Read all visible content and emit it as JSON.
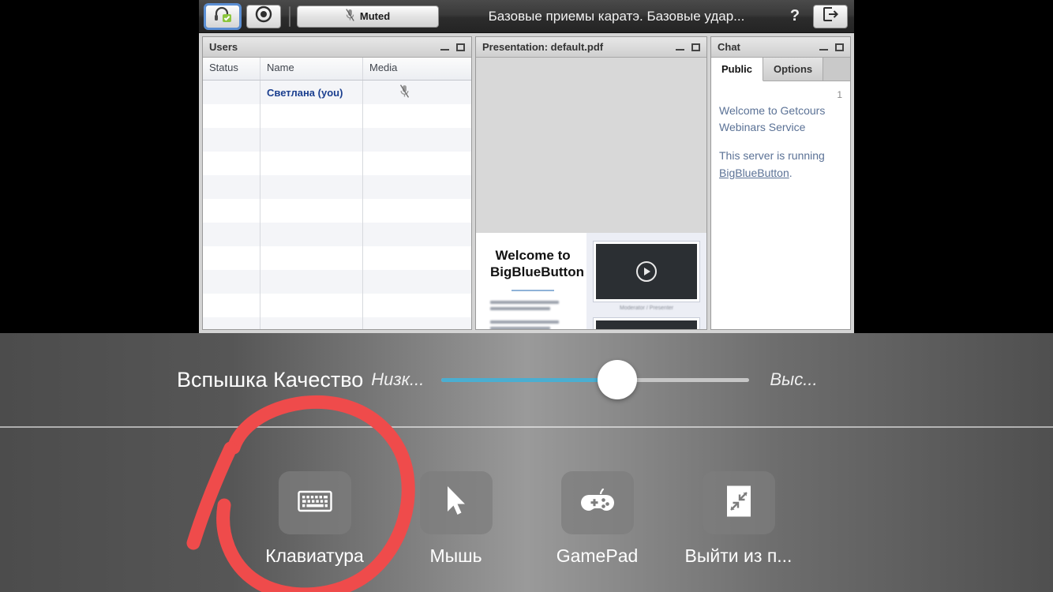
{
  "app": {
    "toolbar": {
      "audio_icon": "headset-check-icon",
      "webcam_icon": "record-circle-icon",
      "mute_button_label": "Muted",
      "mute_icon": "mic-muted-icon",
      "session_title": "Базовые приемы каратэ. Базовые удар...",
      "help_label": "?",
      "logout_icon": "logout-icon"
    },
    "users_panel": {
      "title": "Users",
      "minimize_icon": "minimize-icon",
      "maximize_icon": "maximize-icon",
      "columns": [
        "Status",
        "Name",
        "Media"
      ],
      "rows": [
        {
          "status": "",
          "name": "Светлана (you)",
          "media_icon": "mic-muted-icon",
          "self": true
        }
      ],
      "empty_row_count": 10
    },
    "presentation_panel": {
      "title": "Presentation: default.pdf",
      "minimize_icon": "minimize-icon",
      "maximize_icon": "maximize-icon",
      "slide": {
        "heading_line1": "Welcome to",
        "heading_line2": "BigBlueButton",
        "caption": "Moderator / Presenter"
      }
    },
    "chat_panel": {
      "title": "Chat",
      "minimize_icon": "minimize-icon",
      "maximize_icon": "maximize-icon",
      "tabs": [
        {
          "label": "Public",
          "active": true
        },
        {
          "label": "Options",
          "active": false
        }
      ],
      "timestamp": "1",
      "messages": [
        "Welcome to Getcours",
        "Webinars Service"
      ],
      "server_line": "This server is running",
      "server_link": "BigBlueButton",
      "server_period": "."
    }
  },
  "overlay": {
    "quality": {
      "label": "Вспышка Качество",
      "low_label": "Низк...",
      "high_label": "Выс...",
      "slider_percent": 57,
      "fill_color": "#4aaed1",
      "track_color": "#c6c6c6"
    },
    "buttons": [
      {
        "label": "Клавиатура",
        "icon": "keyboard-icon"
      },
      {
        "label": "Мышь",
        "icon": "cursor-icon"
      },
      {
        "label": "GamePad",
        "icon": "gamepad-icon"
      },
      {
        "label": "Выйти из п...",
        "icon": "exit-fullscreen-icon"
      }
    ]
  },
  "annotation": {
    "shape": "hand-drawn-circle-with-arrow",
    "color": "#ef4b4b",
    "targets": "Клавиатура"
  }
}
